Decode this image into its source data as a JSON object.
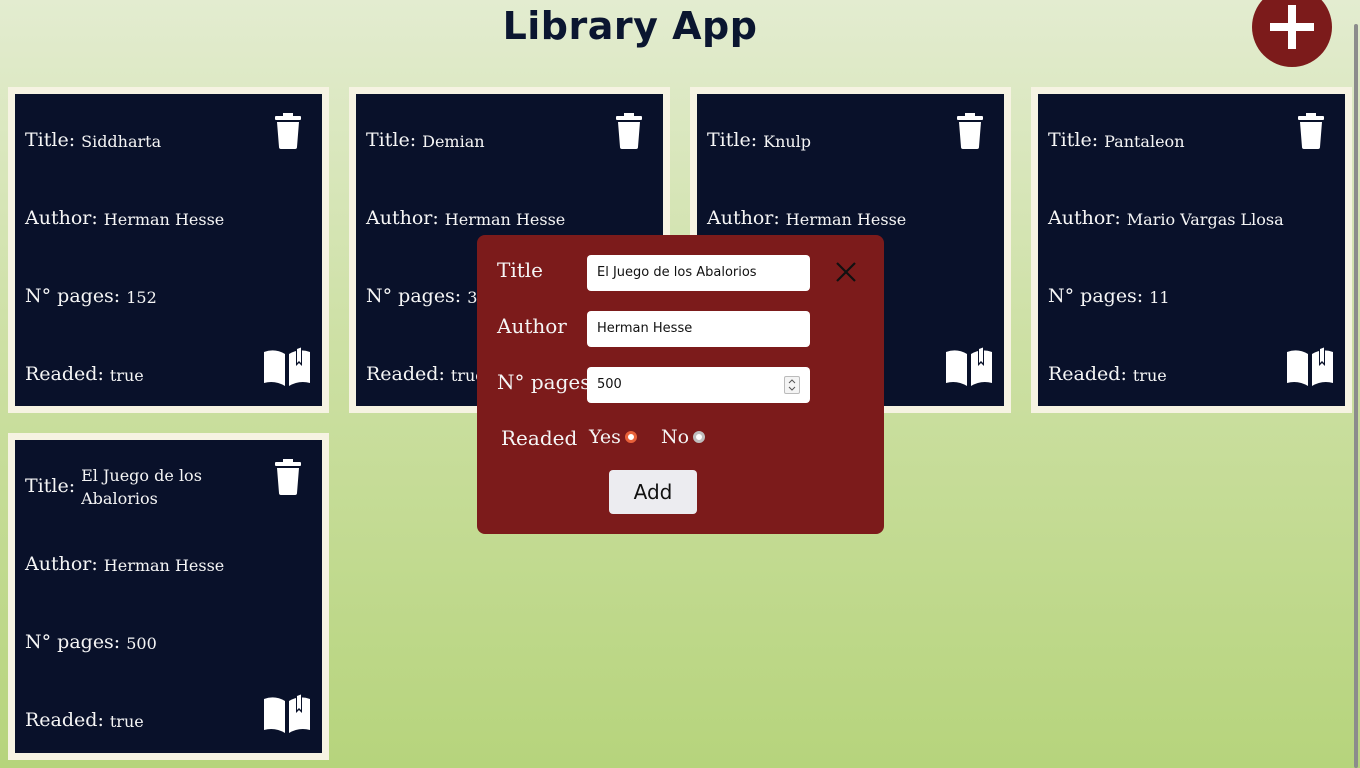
{
  "app": {
    "title": "Library App"
  },
  "books": [
    {
      "title": "Siddharta",
      "author": "Herman Hesse",
      "pages": "152",
      "readed": "true"
    },
    {
      "title": "Demian",
      "author": "Herman Hesse",
      "pages": "36",
      "readed": "true"
    },
    {
      "title": "Knulp",
      "author": "Herman Hesse",
      "pages": "",
      "readed": ""
    },
    {
      "title": "Pantaleon",
      "author": "Mario Vargas Llosa",
      "pages": "11",
      "readed": "true"
    },
    {
      "title": "El Juego de los Abalorios",
      "author": "Herman Hesse",
      "pages": "500",
      "readed": "true"
    }
  ],
  "labels": {
    "title": "Title:",
    "author": "Author:",
    "pages": "N° pages:",
    "readed": "Readed:"
  },
  "form": {
    "title_label": "Title",
    "title_value": "El Juego de los Abalorios",
    "author_label": "Author",
    "author_value": "Herman Hesse",
    "pages_label": "N° pages",
    "pages_value": "500",
    "readed_label": "Readed",
    "yes_label": "Yes",
    "no_label": "No",
    "readed_selected": "Yes",
    "submit_label": "Add"
  },
  "colors": {
    "card_bg": "#09112a",
    "card_border": "#f6f3e2",
    "accent": "#7c1b1b",
    "radio_selected": "#e8613a"
  },
  "icons": {
    "add": "plus-icon",
    "delete": "trash-icon",
    "read_status": "open-book-icon",
    "close": "close-icon"
  }
}
